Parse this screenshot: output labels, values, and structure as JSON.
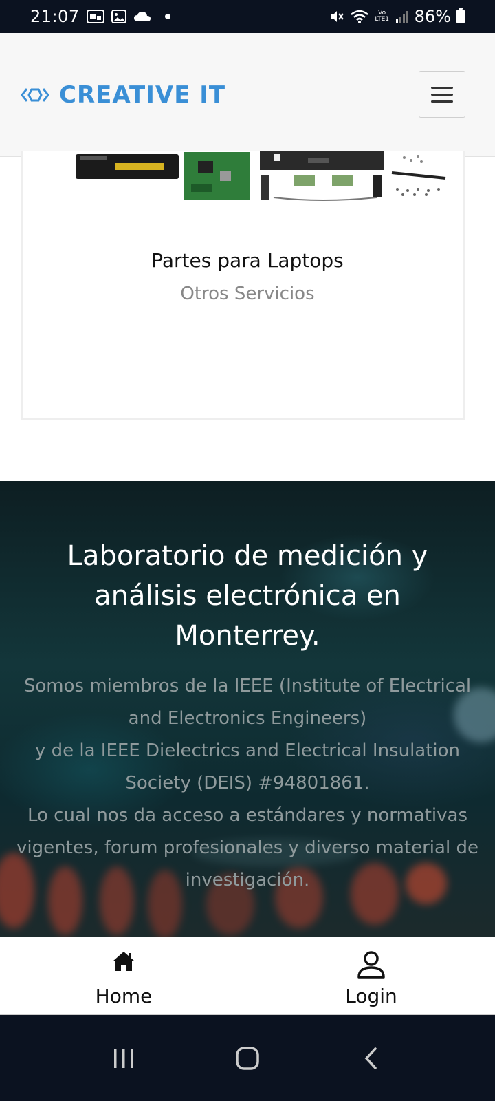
{
  "status_bar": {
    "time": "21:07",
    "icons": [
      "notification-box-icon",
      "image-icon",
      "cloud-icon",
      "dot-icon"
    ],
    "right_icons": [
      "mute-icon",
      "wifi-icon",
      "volte-icon",
      "signal-icon",
      "battery-icon"
    ],
    "volte_label": "Vo LTE1",
    "battery_percent": "86%"
  },
  "header": {
    "logo_text": "CREATIVE IT",
    "menu_icon": "hamburger-menu-icon",
    "brand_color": "#3a8fd6"
  },
  "card": {
    "title": "Partes para Laptops",
    "subtitle": "Otros Servicios"
  },
  "lab": {
    "title": "Laboratorio de medición y análisis electrónica en Monterrey.",
    "body_lines": [
      "Somos miembros de la IEEE (Institute of Electrical and Electronics Engineers)",
      "y de la IEEE Dielectrics and Electrical Insulation Society (DEIS) #94801861.",
      "Lo cual nos da acceso a estándares y normativas vigentes, forum profesionales y diverso material de investigación."
    ]
  },
  "bottom_nav": {
    "items": [
      {
        "label": "Home",
        "icon": "home-icon"
      },
      {
        "label": "Login",
        "icon": "user-icon"
      }
    ]
  },
  "system_nav": {
    "buttons": [
      "recent-apps-icon",
      "home-circle-icon",
      "back-icon"
    ]
  }
}
